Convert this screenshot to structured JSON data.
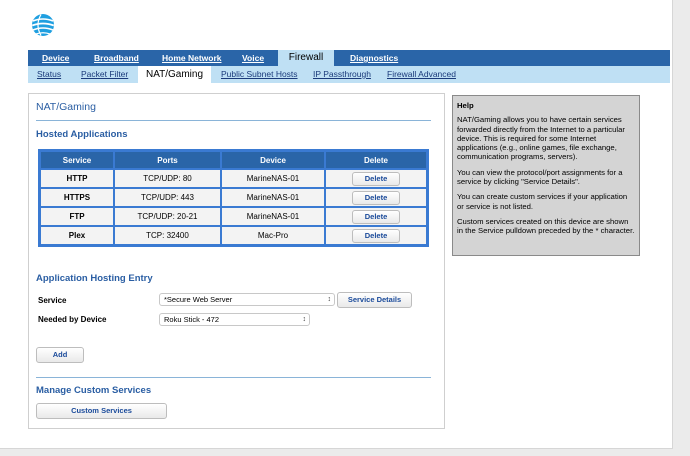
{
  "colors": {
    "nav": "#2a65a8",
    "subnav": "#bfe0f4",
    "heading": "#2a5ea3",
    "help_bg": "#d4d4d4"
  },
  "logo": {
    "icon": "att-globe-icon"
  },
  "top_nav": [
    {
      "label": "Device",
      "active": false
    },
    {
      "label": "Broadband",
      "active": false
    },
    {
      "label": "Home Network",
      "active": false
    },
    {
      "label": "Voice",
      "active": false
    },
    {
      "label": "Firewall",
      "active": true
    },
    {
      "label": "Diagnostics",
      "active": false
    }
  ],
  "sub_nav": [
    {
      "label": "Status",
      "active": false
    },
    {
      "label": "Packet Filter",
      "active": false
    },
    {
      "label": "NAT/Gaming",
      "active": true
    },
    {
      "label": "Public Subnet Hosts",
      "active": false
    },
    {
      "label": "IP Passthrough",
      "active": false
    },
    {
      "label": "Firewall Advanced",
      "active": false
    }
  ],
  "main": {
    "title": "NAT/Gaming",
    "hosted": {
      "title": "Hosted Applications",
      "columns": [
        "Service",
        "Ports",
        "Device",
        "Delete"
      ],
      "rows": [
        {
          "service": "HTTP",
          "ports": "TCP/UDP: 80",
          "device": "MarineNAS-01",
          "delete_label": "Delete"
        },
        {
          "service": "HTTPS",
          "ports": "TCP/UDP: 443",
          "device": "MarineNAS-01",
          "delete_label": "Delete"
        },
        {
          "service": "FTP",
          "ports": "TCP/UDP: 20-21",
          "device": "MarineNAS-01",
          "delete_label": "Delete"
        },
        {
          "service": "Plex",
          "ports": "TCP: 32400",
          "device": "Mac-Pro",
          "delete_label": "Delete"
        }
      ]
    },
    "entry": {
      "title": "Application Hosting Entry",
      "service_label": "Service",
      "service_value": "*Secure Web Server",
      "details_button": "Service Details",
      "device_label": "Needed by Device",
      "device_value": "Roku Stick - 472",
      "add_button": "Add"
    },
    "custom": {
      "title": "Manage Custom Services",
      "button": "Custom Services"
    }
  },
  "help": {
    "title": "Help",
    "paragraphs": [
      "NAT/Gaming allows you to have certain services forwarded directly from the Internet to a particular device. This is required for some Internet applications (e.g., online games, file exchange, communication programs, servers).",
      "You can view the protocol/port assignments for a service by clicking \"Service Details\".",
      "You can create custom services if your application or service is not listed.",
      "Custom services created on this device are shown in the Service pulldown preceded by the * character."
    ]
  }
}
